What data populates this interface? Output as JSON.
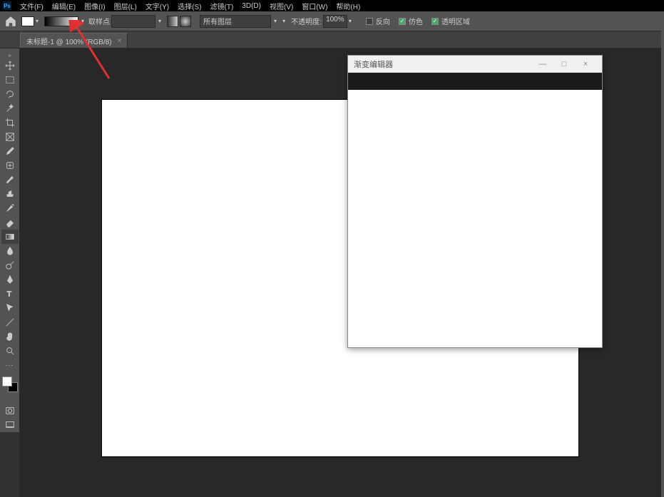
{
  "menu": {
    "items": [
      "文件(F)",
      "编辑(E)",
      "图像(I)",
      "图层(L)",
      "文字(Y)",
      "选择(S)",
      "滤镜(T)",
      "3D(D)",
      "视图(V)",
      "窗口(W)",
      "帮助(H)"
    ]
  },
  "options": {
    "sample_label": "取样点",
    "sample_value": "",
    "layer_scope_value": "所有图层",
    "opacity_label": "不透明度:",
    "opacity_value": "100%",
    "reverse_label": "反向",
    "reverse_checked": false,
    "dither_label": "仿色",
    "dither_checked": true,
    "transparency_label": "透明区域",
    "transparency_checked": true
  },
  "tab": {
    "title": "未标题-1 @ 100% (RGB/8)",
    "close": "×"
  },
  "dialog": {
    "title": "渐变编辑器",
    "minimize": "—",
    "maximize": "□",
    "close": "×"
  },
  "tools": {
    "list": [
      {
        "name": "move-tool"
      },
      {
        "name": "rectangular-marquee-tool"
      },
      {
        "name": "lasso-tool"
      },
      {
        "name": "magic-wand-tool"
      },
      {
        "name": "crop-tool"
      },
      {
        "name": "frame-tool"
      },
      {
        "name": "eyedropper-tool"
      },
      {
        "name": "healing-brush-tool"
      },
      {
        "name": "brush-tool"
      },
      {
        "name": "clone-stamp-tool"
      },
      {
        "name": "history-brush-tool"
      },
      {
        "name": "eraser-tool"
      },
      {
        "name": "gradient-tool"
      },
      {
        "name": "blur-tool"
      },
      {
        "name": "dodge-tool"
      },
      {
        "name": "pen-tool"
      },
      {
        "name": "type-tool"
      },
      {
        "name": "path-selection-tool"
      },
      {
        "name": "line-tool"
      },
      {
        "name": "hand-tool"
      },
      {
        "name": "zoom-tool"
      }
    ]
  }
}
